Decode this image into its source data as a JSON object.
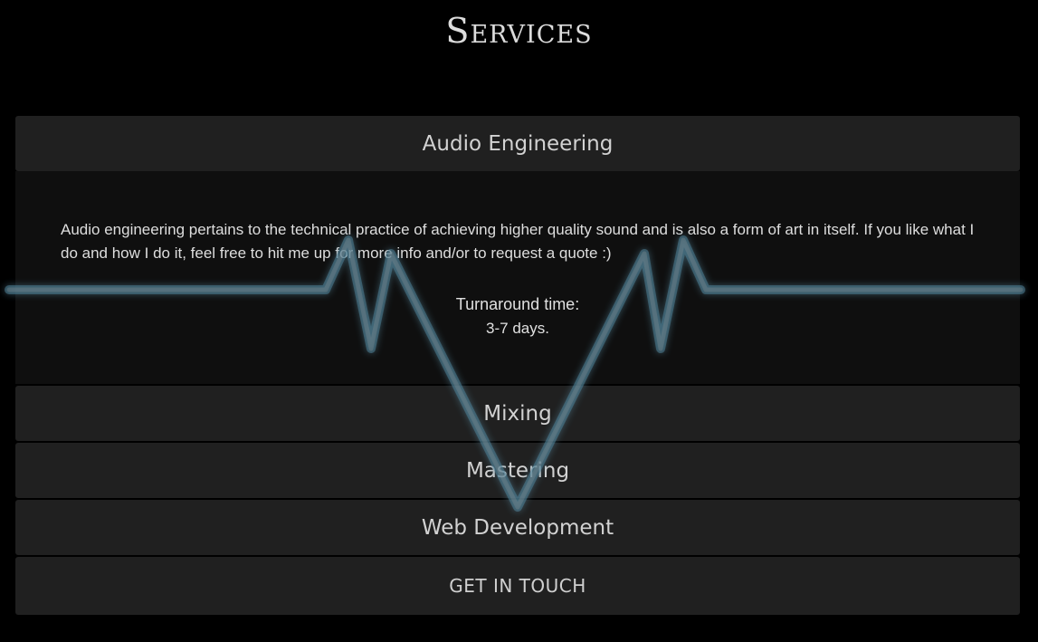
{
  "page": {
    "title": "Services"
  },
  "accordion": {
    "sections": [
      {
        "label": "Audio Engineering",
        "expanded": true,
        "description": "Audio engineering pertains to the technical practice of achieving higher quality sound and is also a form of art in itself. If you like what I do and how I do it, feel free to hit me up for more info and/or to request a quote :)",
        "turnaround_label": "Turnaround time:",
        "turnaround_value": "3-7 days."
      },
      {
        "label": "Mixing",
        "expanded": false
      },
      {
        "label": "Mastering",
        "expanded": false
      },
      {
        "label": "Web Development",
        "expanded": false
      }
    ]
  },
  "cta": {
    "label": "GET IN TOUCH"
  },
  "colors": {
    "background": "#000000",
    "header_bg": "#202020",
    "panel_bg": "#0f0f0f",
    "wave_glow": "#5a8fa8"
  }
}
